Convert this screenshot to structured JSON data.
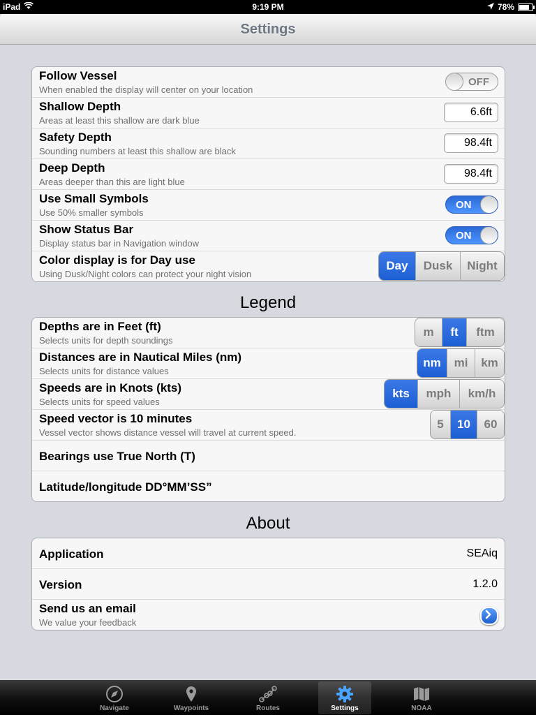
{
  "status_bar": {
    "device": "iPad",
    "time": "9:19 PM",
    "battery": "78%",
    "battery_fill": 0.78
  },
  "nav": {
    "title": "Settings"
  },
  "settings": {
    "follow_vessel": {
      "title": "Follow Vessel",
      "subtitle": "When enabled the display will center on your location",
      "state": "OFF"
    },
    "shallow_depth": {
      "title": "Shallow Depth",
      "subtitle": "Areas at least this shallow are dark blue",
      "value": "6.6ft"
    },
    "safety_depth": {
      "title": "Safety Depth",
      "subtitle": "Sounding numbers at least this shallow are black",
      "value": "98.4ft"
    },
    "deep_depth": {
      "title": "Deep Depth",
      "subtitle": "Areas deeper than this are light blue",
      "value": "98.4ft"
    },
    "small_symbols": {
      "title": "Use Small Symbols",
      "subtitle": "Use 50% smaller symbols",
      "state": "ON"
    },
    "status_bar_toggle": {
      "title": "Show Status Bar",
      "subtitle": "Display status bar in Navigation window",
      "state": "ON"
    },
    "color_display": {
      "title": "Color display is for Day use",
      "subtitle": "Using Dusk/Night colors can protect your night vision",
      "options": [
        "Day",
        "Dusk",
        "Night"
      ],
      "selected": "Day"
    }
  },
  "legend": {
    "title": "Legend",
    "depths": {
      "title": "Depths are in Feet (ft)",
      "subtitle": "Selects units for depth soundings",
      "options": [
        "m",
        "ft",
        "ftm"
      ],
      "selected": "ft"
    },
    "distances": {
      "title": "Distances are in Nautical Miles (nm)",
      "subtitle": "Selects units for distance values",
      "options": [
        "nm",
        "mi",
        "km"
      ],
      "selected": "nm"
    },
    "speeds": {
      "title": "Speeds are in Knots (kts)",
      "subtitle": "Selects units for speed values",
      "options": [
        "kts",
        "mph",
        "km/h"
      ],
      "selected": "kts"
    },
    "speed_vector": {
      "title": "Speed vector is 10 minutes",
      "subtitle": "Vessel vector shows distance vessel will travel at current speed.",
      "options": [
        "5",
        "10",
        "60"
      ],
      "selected": "10"
    },
    "bearings": {
      "title": "Bearings use True North (T)"
    },
    "latlon": {
      "title": "Latitude/longitude DD°MM’SS”"
    }
  },
  "about": {
    "title": "About",
    "application": {
      "label": "Application",
      "value": "SEAiq"
    },
    "version": {
      "label": "Version",
      "value": "1.2.0"
    },
    "email": {
      "title": "Send us an email",
      "subtitle": "We value your feedback"
    }
  },
  "tabs": [
    {
      "label": "Navigate",
      "icon": "compass-icon"
    },
    {
      "label": "Waypoints",
      "icon": "map-pin-icon"
    },
    {
      "label": "Routes",
      "icon": "route-icon"
    },
    {
      "label": "Settings",
      "icon": "gear-icon",
      "active": true
    },
    {
      "label": "NOAA",
      "icon": "chart-map-icon"
    }
  ],
  "colors": {
    "accent": "#2a6ad6",
    "background": "#d6d9df",
    "nav_title": "#6d7683"
  }
}
